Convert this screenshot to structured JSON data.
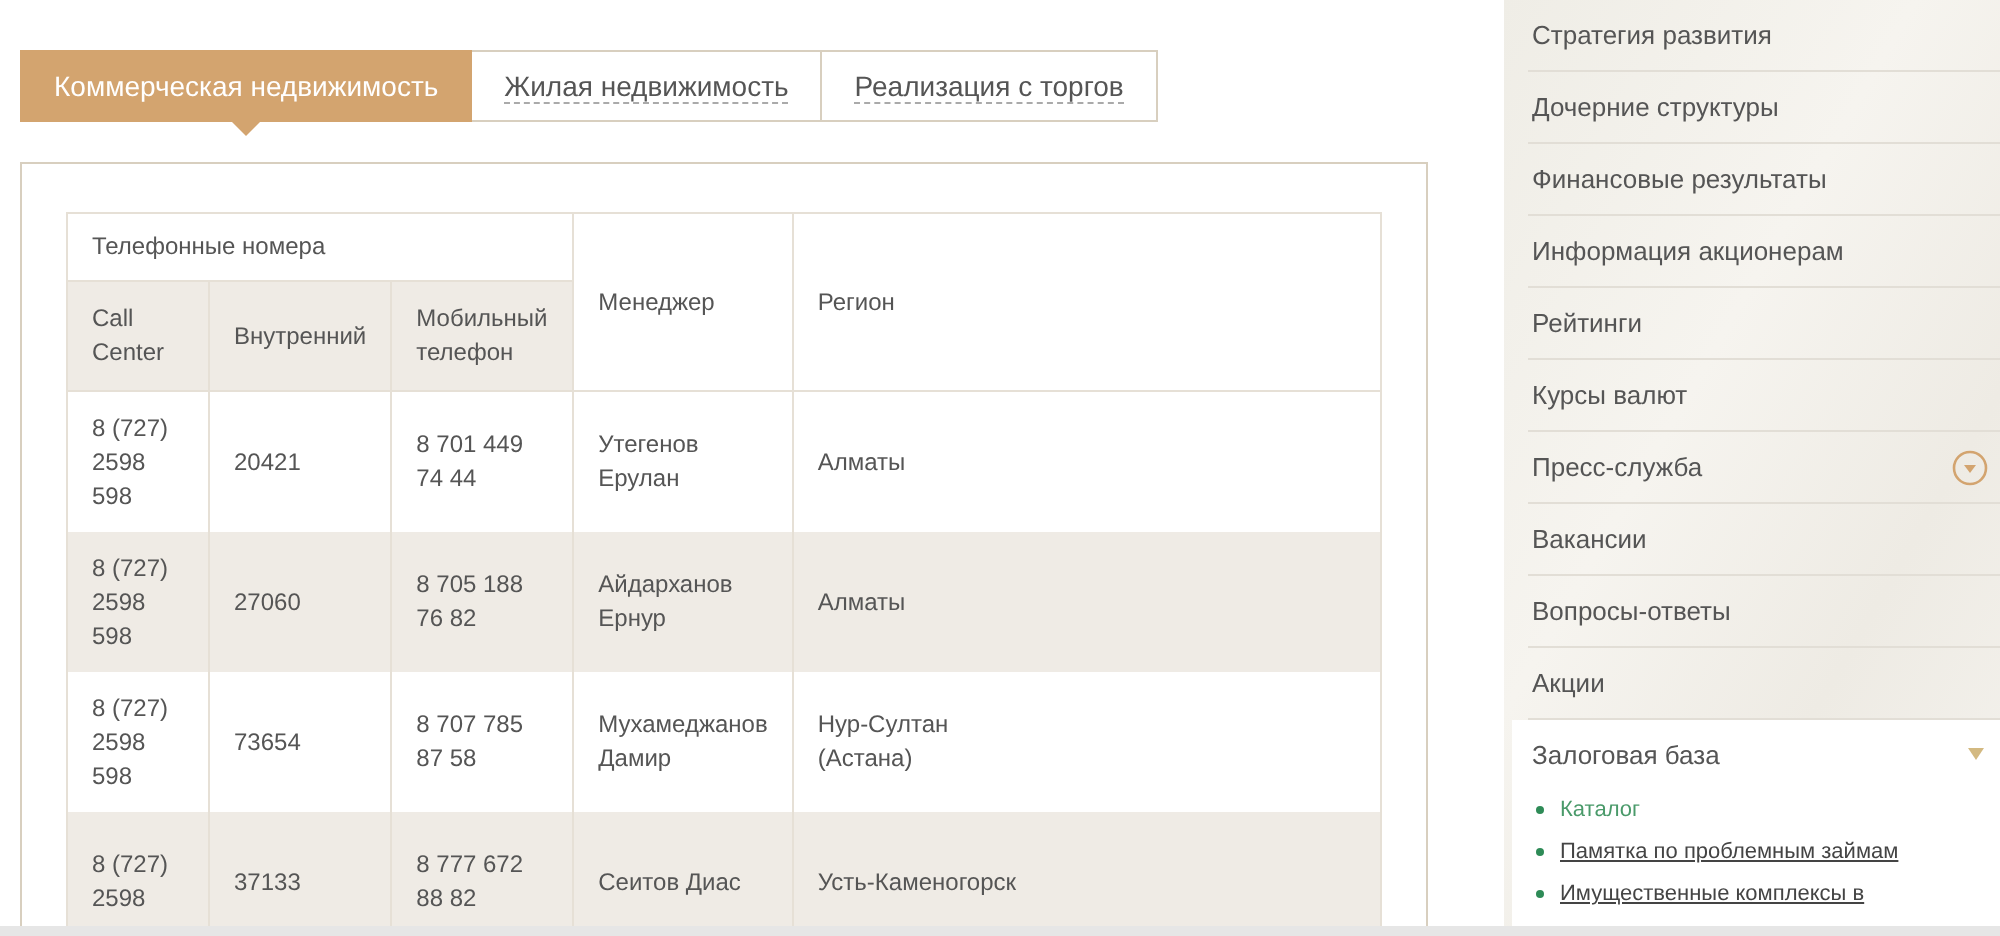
{
  "tabs": [
    {
      "label": "Коммерческая недвижимость",
      "selected": true
    },
    {
      "label": "Жилая недвижимость",
      "selected": false
    },
    {
      "label": "Реализация с торгов",
      "selected": false
    }
  ],
  "table": {
    "group_header": "Телефонные номера",
    "columns": [
      "Call Center",
      "Внутренний",
      "Мобильный телефон",
      "Менеджер",
      "Регион"
    ],
    "rows": [
      {
        "call_center": "8 (727) 2598 598",
        "internal": "20421",
        "mobile": "8 701 449 74 44",
        "manager": "Утегенов Ерулан",
        "region": "Алматы"
      },
      {
        "call_center": "8 (727) 2598 598",
        "internal": "27060",
        "mobile": "8 705 188 76 82",
        "manager": "Айдарханов Ернур",
        "region": "Алматы"
      },
      {
        "call_center": "8 (727) 2598 598",
        "internal": "73654",
        "mobile": "8 707 785 87 58",
        "manager": "Мухамеджанов Дамир",
        "region": "Нур-Султан\n(Астана)"
      },
      {
        "call_center": "8 (727) 2598",
        "internal": "37133",
        "mobile": "8 777 672 88 82",
        "manager": "Сеитов Диас",
        "region": "Усть-Каменогорск"
      }
    ]
  },
  "sidebar": {
    "items": [
      {
        "label": "Стратегия развития",
        "kind": "link"
      },
      {
        "label": "Дочерние структуры",
        "kind": "link"
      },
      {
        "label": "Финансовые результаты",
        "kind": "link"
      },
      {
        "label": "Информация акционерам",
        "kind": "link"
      },
      {
        "label": "Рейтинги",
        "kind": "link"
      },
      {
        "label": "Курсы валют",
        "kind": "link"
      },
      {
        "label": "Пресс-служба",
        "kind": "group",
        "expanded": false
      },
      {
        "label": "Вакансии",
        "kind": "link"
      },
      {
        "label": "Вопросы-ответы",
        "kind": "link"
      },
      {
        "label": "Акции",
        "kind": "link"
      },
      {
        "label": "Залоговая база",
        "kind": "group",
        "expanded": true,
        "children": [
          {
            "label": "Каталог",
            "selected": true
          },
          {
            "label": "Памятка по проблемным займам",
            "selected": false
          },
          {
            "label": "Имущественные комплексы в",
            "selected": false
          }
        ]
      }
    ]
  }
}
